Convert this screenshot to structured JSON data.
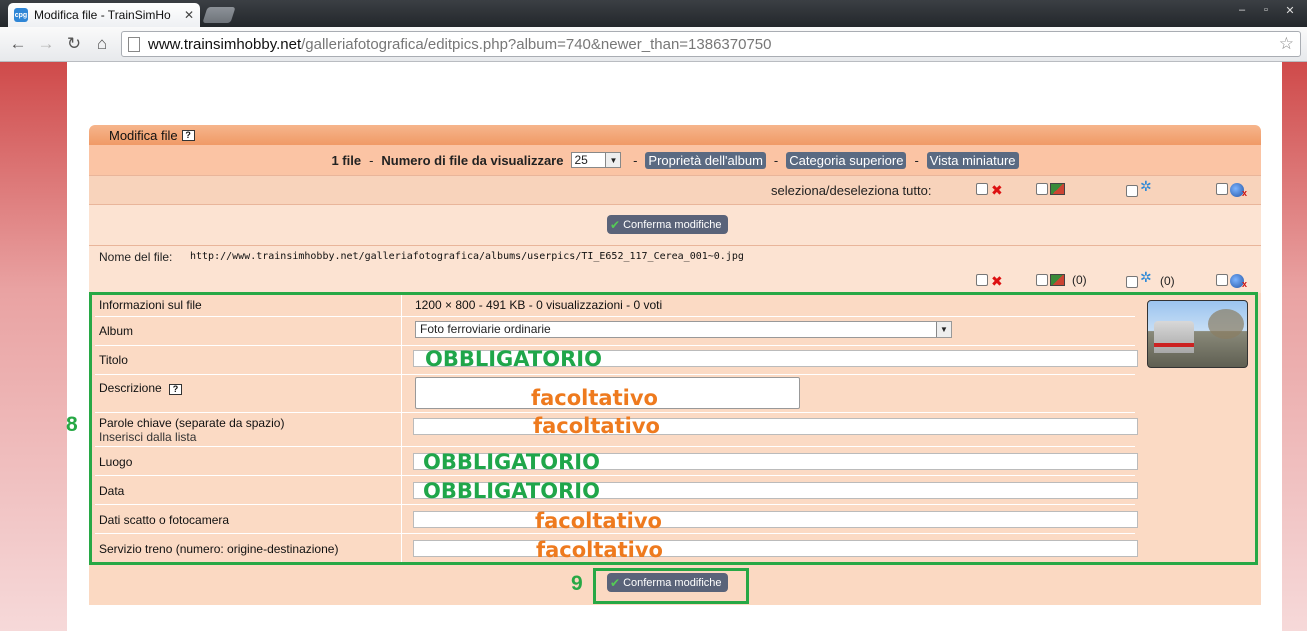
{
  "browser": {
    "tab_title": "Modifica file - TrainSimHo",
    "tab_favicon": "cpg",
    "url_domain": "www.trainsimhobby.net",
    "url_path": "/galleriafotografica/editpics.php?album=740&newer_than=1386370750"
  },
  "panel": {
    "title": "Modifica file",
    "nav": {
      "file_count": "1 file",
      "per_page_label": "Numero di file da visualizzare",
      "per_page_value": "25",
      "links": [
        "Proprietà dell'album",
        "Categoria superiore",
        "Vista miniature"
      ]
    },
    "select_all_label": "seleziona/deseleziona tutto:",
    "confirm_label": "Conferma modifiche",
    "file_name_label": "Nome del file:",
    "file_name_value": "http://www.trainsimhobby.net/galleriafotografica/albums/userpics/TI_E652_117_Cerea_001~0.jpg",
    "counts": [
      "(0)",
      "(0)"
    ]
  },
  "form": {
    "info_label": "Informazioni sul file",
    "info_value": "1200 × 800 - 491 KB - 0 visualizzazioni - 0 voti",
    "album_label": "Album",
    "album_value": "Foto ferroviarie ordinarie",
    "title_label": "Titolo",
    "description_label": "Descrizione",
    "keywords_label": "Parole chiave (separate da spazio)",
    "keywords_sub": "Inserisci dalla lista",
    "place_label": "Luogo",
    "date_label": "Data",
    "camera_label": "Dati scatto o fotocamera",
    "service_label": "Servizio treno (numero: origine-destinazione)"
  },
  "annotations": {
    "required": "OBBLIGATORIO",
    "optional": "facoltativo",
    "marker_8": "8",
    "marker_9": "9"
  },
  "colors": {
    "accent_green": "#27a845",
    "annot_orange": "#ee7a1e",
    "header_orange": "#f09a66"
  }
}
